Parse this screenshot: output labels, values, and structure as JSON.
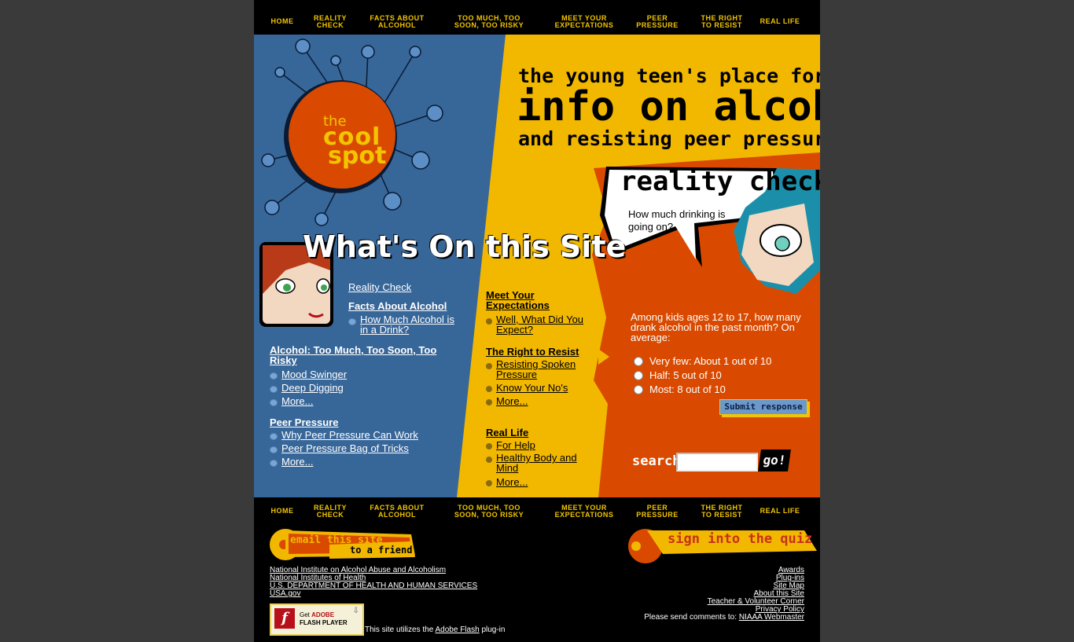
{
  "nav": {
    "home": "HOME",
    "reality_check": "REALITY CHECK",
    "facts": "FACTS ABOUT ALCOHOL",
    "too_much": "TOO MUCH, TOO SOON, TOO RISKY",
    "expectations": "MEET YOUR EXPECTATIONS",
    "peer": "PEER PRESSURE",
    "right": "THE RIGHT TO RESIST",
    "real_life": "REAL LIFE"
  },
  "logo": {
    "the": "the",
    "cool": "cool",
    "spot": "spot"
  },
  "tagline": {
    "line1": "the young teen's place for",
    "line2": "info on alcohol",
    "line3": "and resisting peer pressure"
  },
  "whats_on": "What's On this Site",
  "reality": {
    "title": "reality check",
    "bubble": "How much drinking is going on?",
    "question": "Among kids ages 12 to 17, how many drank alcohol in the past month? On average:",
    "options": [
      "Very few: About 1 out of 10",
      "Half: 5 out of 10",
      "Most: 8 out of 10"
    ],
    "submit": "Submit response"
  },
  "links": {
    "reality_check": "Reality Check",
    "facts": "Facts About Alcohol",
    "facts_items": [
      "How Much Alcohol is in a Drink?"
    ],
    "too_much": "Alcohol: Too Much, Too Soon, Too Risky",
    "too_much_items": [
      "Mood Swinger",
      "Deep Digging",
      "More..."
    ],
    "peer": "Peer Pressure",
    "peer_items": [
      "Why Peer Pressure Can Work",
      "Peer Pressure Bag of Tricks",
      "More..."
    ],
    "expect": "Meet Your Expectations",
    "expect_items": [
      "Well, What Did You Expect?"
    ],
    "right": "The Right to Resist",
    "right_items": [
      "Resisting Spoken Pressure",
      "Know Your No's",
      "More..."
    ],
    "real_life": "Real Life",
    "real_life_items": [
      "For Help",
      "Healthy Body and Mind",
      "More..."
    ]
  },
  "search": {
    "label": "search",
    "go": "go!",
    "value": ""
  },
  "footer": {
    "email1": "email this site",
    "email2": "to a friend",
    "quiz": "sign into the quiz",
    "left_links": [
      "National Institute on Alcohol Abuse and Alcoholism",
      "National Institutes of Health",
      "U.S. DEPARTMENT OF HEALTH AND HUMAN SERVICES",
      "USA.gov"
    ],
    "right_links": [
      "Awards",
      "Plug-ins",
      "Site Map",
      "About this Site",
      "Teacher & Volunteer Corner",
      "Privacy Policy"
    ],
    "comments_prefix": "Please send comments to:",
    "comments_link": "NIAAA Webmaster",
    "flash_get": "Get",
    "flash_adobe": "ADOBE",
    "flash_player": "FLASH PLAYER",
    "flash_note_prefix": "This site utilizes the",
    "flash_note_link": "Adobe Flash",
    "flash_note_suffix": "plug-in"
  },
  "colors": {
    "blue": "#376699",
    "yellow": "#f2b800",
    "orange": "#d94a00",
    "nav_text": "#f2c500"
  }
}
